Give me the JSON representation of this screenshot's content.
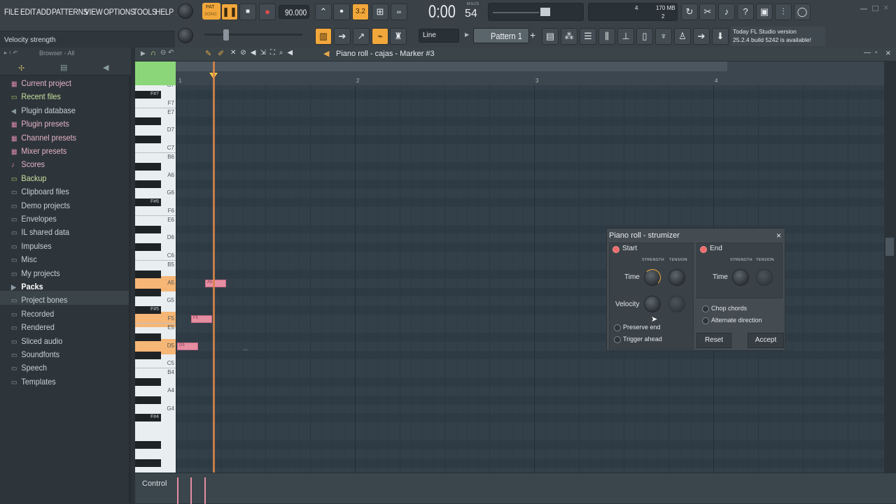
{
  "menu": [
    "FILE",
    "EDIT",
    "ADD",
    "PATTERNS",
    "VIEW",
    "OPTIONS",
    "TOOLS",
    "HELP"
  ],
  "hint": "Velocity strength",
  "transport": {
    "pat_label": "PAT",
    "song_label": "SONG",
    "tempo": "90.000",
    "time": "0:00",
    "time_sub": "54",
    "time_unit": "M:S:CS",
    "snap": "3.2",
    "cpu_mem": "170 MB",
    "cpu_value": "4",
    "cpu_poly": "2"
  },
  "toolbar2": {
    "mode": "Line",
    "pattern": "Pattern 1"
  },
  "news": {
    "line1": "Today  FL Studio version",
    "line2": "25.2.4 build 5242 is available!"
  },
  "browser": {
    "header": "Browser - All",
    "items": [
      {
        "label": "Current project",
        "style": "pink"
      },
      {
        "label": "Recent files",
        "style": "green"
      },
      {
        "label": "Plugin database",
        "style": "default"
      },
      {
        "label": "Plugin presets",
        "style": "pink"
      },
      {
        "label": "Channel presets",
        "style": "pink"
      },
      {
        "label": "Mixer presets",
        "style": "pink"
      },
      {
        "label": "Scores",
        "style": "pink"
      },
      {
        "label": "Backup",
        "style": "green"
      },
      {
        "label": "Clipboard files",
        "style": "default"
      },
      {
        "label": "Demo projects",
        "style": "default"
      },
      {
        "label": "Envelopes",
        "style": "default"
      },
      {
        "label": "IL shared data",
        "style": "default"
      },
      {
        "label": "Impulses",
        "style": "default"
      },
      {
        "label": "Misc",
        "style": "default"
      },
      {
        "label": "My projects",
        "style": "default"
      },
      {
        "label": "Packs",
        "style": "active"
      },
      {
        "label": "Project bones",
        "style": "default"
      },
      {
        "label": "Recorded",
        "style": "default"
      },
      {
        "label": "Rendered",
        "style": "default"
      },
      {
        "label": "Sliced audio",
        "style": "default"
      },
      {
        "label": "Soundfonts",
        "style": "default"
      },
      {
        "label": "Speech",
        "style": "default"
      },
      {
        "label": "Templates",
        "style": "default"
      }
    ]
  },
  "piano_roll": {
    "title": "Piano roll - cajas - Marker #3",
    "bars": [
      "1",
      "2",
      "3",
      "4"
    ],
    "control_label": "Control",
    "white_keys": [
      "G7",
      "F7",
      "E7",
      "D7",
      "C7",
      "B6",
      "A6",
      "G6",
      "F6",
      "E6",
      "D6",
      "C6",
      "B5",
      "A5",
      "G5",
      "F5",
      "E5",
      "D5",
      "C5",
      "B4",
      "A4",
      "G4"
    ],
    "black_keys": [
      "F#7",
      "F#6",
      "F#5",
      "F#4"
    ],
    "notes": [
      {
        "pitch": "A5",
        "label": "A5"
      },
      {
        "pitch": "F5",
        "label": "F5"
      },
      {
        "pitch": "D5",
        "label": "D5"
      }
    ]
  },
  "strumizer": {
    "title": "Piano roll - strumizer",
    "start_label": "Start",
    "end_label": "End",
    "strength_label": "STRENGTH",
    "tension_label": "TENSION",
    "time_label": "Time",
    "velocity_label": "Velocity",
    "preserve_end": "Preserve end",
    "trigger_ahead": "Trigger ahead",
    "chop_chords": "Chop chords",
    "alternate_direction": "Alternate direction",
    "reset": "Reset",
    "accept": "Accept",
    "close": "×"
  }
}
